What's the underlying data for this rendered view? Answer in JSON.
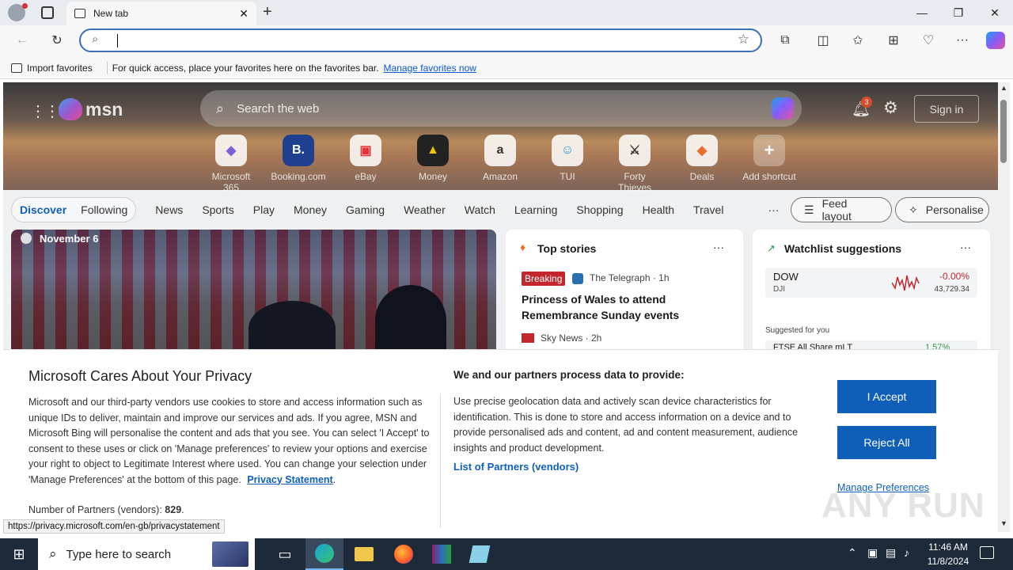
{
  "browser": {
    "tab_title": "New tab",
    "favbar_import": "Import favorites",
    "favbar_hint": "For quick access, place your favorites here on the favorites bar.",
    "favbar_link": "Manage favorites now"
  },
  "msn": {
    "logo": "msn",
    "search_placeholder": "Search the web",
    "notif_count": "3",
    "signin": "Sign in",
    "shortcuts": [
      {
        "label": "Microsoft 365",
        "icon": "m365-icon"
      },
      {
        "label": "Booking.com",
        "icon": "B."
      },
      {
        "label": "eBay",
        "icon": "ebay-icon"
      },
      {
        "label": "Money",
        "icon": "chart-icon"
      },
      {
        "label": "Amazon",
        "icon": "a"
      },
      {
        "label": "TUI",
        "icon": "tui-icon"
      },
      {
        "label": "Forty Thieves",
        "icon": "swords-icon"
      },
      {
        "label": "Deals",
        "icon": "tag-icon"
      },
      {
        "label": "Add shortcut",
        "icon": "+"
      }
    ],
    "nav": {
      "discover": "Discover",
      "following": "Following",
      "items": [
        "News",
        "Sports",
        "Play",
        "Money",
        "Gaming",
        "Weather",
        "Watch",
        "Learning",
        "Shopping",
        "Health",
        "Travel"
      ],
      "more": "···",
      "feed_layout": "Feed layout",
      "personalise": "Personalise"
    },
    "hero_card": {
      "date": "November 6"
    },
    "top_stories": {
      "title": "Top stories",
      "badge": "Breaking",
      "source": "The Telegraph · 1h",
      "headline": "Princess of Wales to attend Remembrance Sunday events",
      "source2": "Sky News · 2h"
    },
    "watchlist": {
      "title": "Watchlist suggestions",
      "symbol": "DOW",
      "sub": "DJI",
      "change": "-0.00%",
      "price": "43,729.34",
      "suggested": "Suggested for you",
      "row2": "FTSE All Share mI T",
      "row2_change": "1.57%"
    }
  },
  "privacy": {
    "title": "Microsoft Cares About Your Privacy",
    "body": "Microsoft and our third-party vendors use cookies to store and access information such as unique IDs to deliver, maintain and improve our services and ads. If you agree, MSN and Microsoft Bing will personalise the content and ads that you see. You can select 'I Accept' to consent to these uses or click on 'Manage preferences' to review your options and exercise your right to object to Legitimate Interest where used. You can change your selection under 'Manage Preferences' at the bottom of this page.",
    "link": "Privacy Statement",
    "partners_label": "Number of Partners (vendors):",
    "partners_count": "829",
    "process_title": "We and our partners process data to provide:",
    "process_body": "Use precise geolocation data and actively scan device characteristics for identification. This is done to store and access information on a device and to provide personalised ads and content, ad and content measurement, audience insights and product development.",
    "partners_link": "List of Partners (vendors)",
    "accept": "I Accept",
    "reject": "Reject All",
    "manage": "Manage Preferences",
    "status_url": "https://privacy.microsoft.com/en-gb/privacystatement"
  },
  "taskbar": {
    "search_placeholder": "Type here to search",
    "time": "11:46 AM",
    "date": "11/8/2024"
  },
  "watermark": "ANY RUN"
}
